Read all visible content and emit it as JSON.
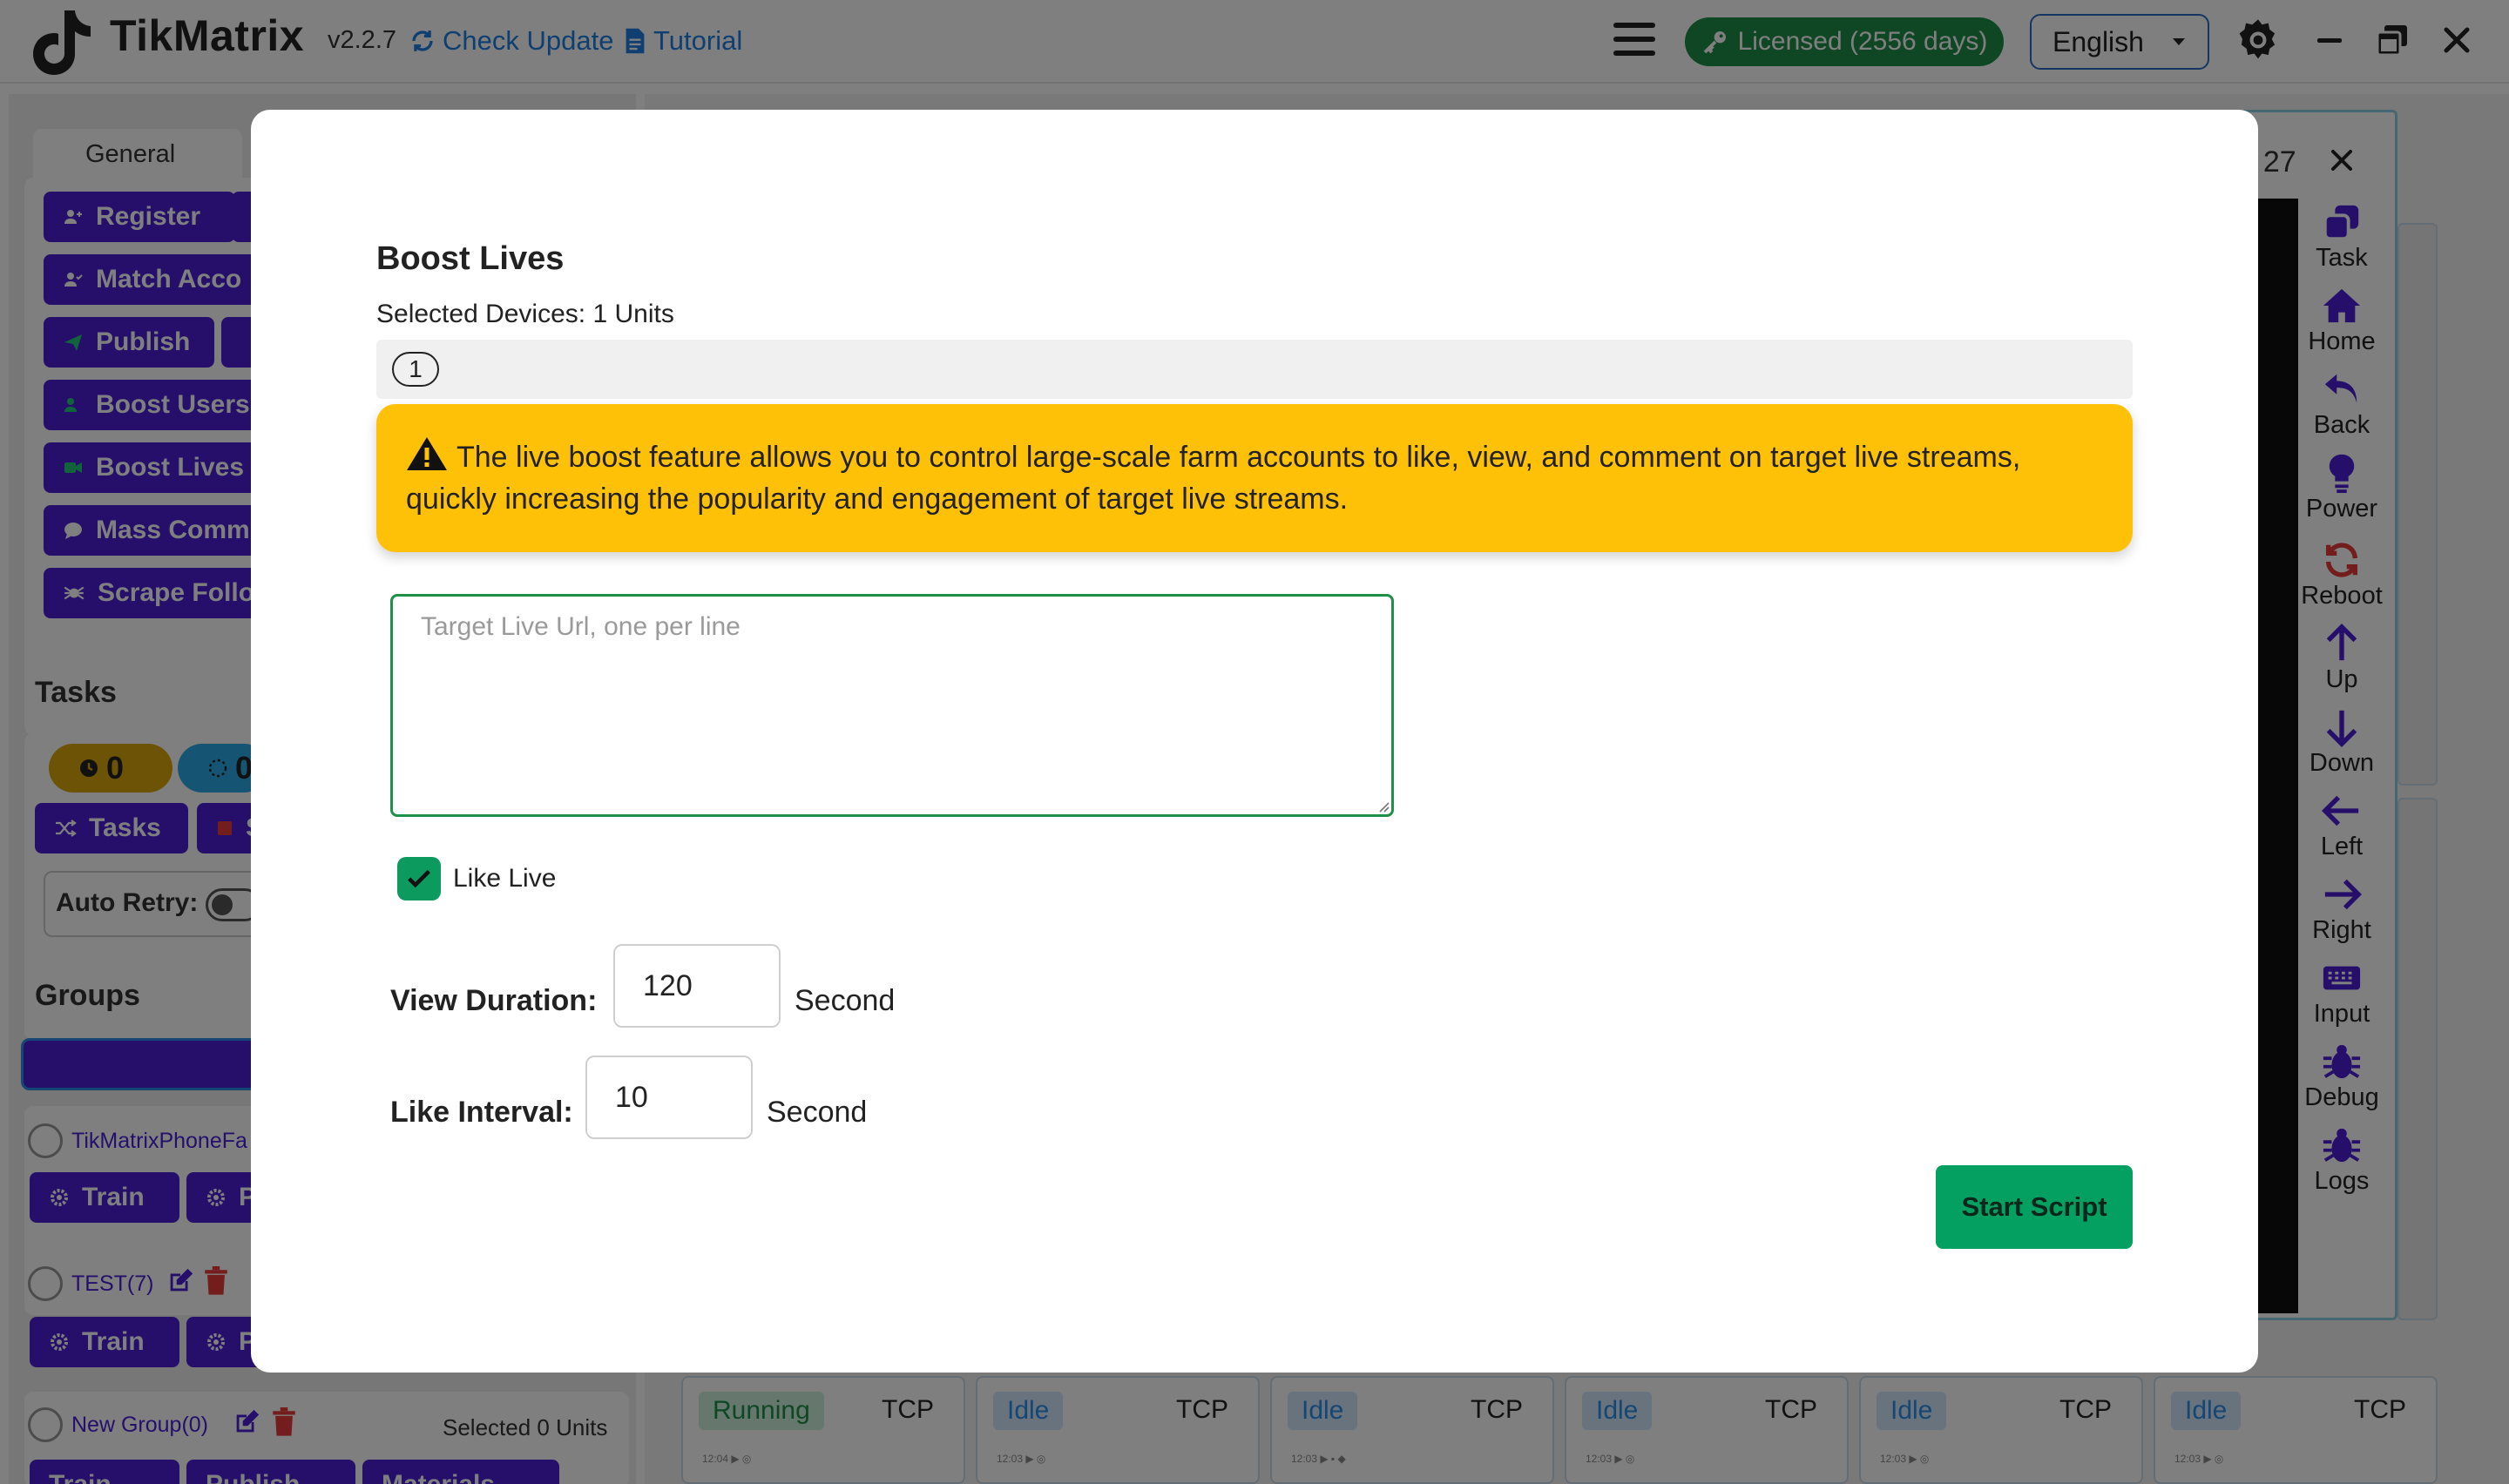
{
  "app": {
    "name": "TikMatrix",
    "version": "v2.2.7",
    "check_update": "Check Update",
    "tutorial": "Tutorial",
    "licensed": "Licensed (2556 days)",
    "language": "English"
  },
  "sidebar": {
    "general_tab": "General",
    "general_buttons": [
      "Register",
      "Match Acco",
      "Publish",
      "Boost Users",
      "Boost Lives",
      "Mass Comm",
      "Scrape Follo"
    ],
    "tasks": {
      "title": "Tasks",
      "count_a": "0",
      "count_b": "0",
      "tasks_button": "Tasks",
      "stop_button": "S",
      "auto_retry": "Auto Retry:"
    },
    "groups": {
      "title": "Groups",
      "list": [
        {
          "name": "TikMatrixPhoneFa",
          "train": "Train",
          "second": "P"
        },
        {
          "name": "TEST(7)",
          "train": "Train",
          "second": "P"
        },
        {
          "name": "New Group(0)",
          "selected": "Selected 0 Units",
          "train": "Train",
          "publish": "Publish",
          "materials": "Materials"
        }
      ]
    }
  },
  "device_panel": {
    "count_fragment": ": 27",
    "controls": [
      "Task",
      "Home",
      "Back",
      "Power",
      "Reboot",
      "Up",
      "Down",
      "Left",
      "Right",
      "Input",
      "Debug",
      "Logs"
    ]
  },
  "device_cards": [
    {
      "status": "Running",
      "conn": "TCP",
      "mini": "12:04 ▶ ◎"
    },
    {
      "status": "Idle",
      "conn": "TCP",
      "mini": "12:03 ▶ ◎"
    },
    {
      "status": "Idle",
      "conn": "TCP",
      "mini": "12:03 ▶ ▪ ◆"
    },
    {
      "status": "Idle",
      "conn": "TCP",
      "mini": "12:03 ▶ ◎"
    },
    {
      "status": "Idle",
      "conn": "TCP",
      "mini": "12:03 ▶ ◎"
    },
    {
      "status": "Idle",
      "conn": "TCP",
      "mini": "12:03 ▶ ◎"
    }
  ],
  "modal": {
    "title": "Boost Lives",
    "selected_devices": "Selected Devices: 1 Units",
    "device_chip": "1",
    "warning": "The live boost feature allows you to control large-scale farm accounts to like, view, and comment on target live streams, quickly increasing the popularity and engagement of target live streams.",
    "url_placeholder": "Target Live Url, one per line",
    "like_live_label": "Like Live",
    "like_live_checked": true,
    "view_duration_label": "View Duration:",
    "view_duration_value": "120",
    "view_duration_unit": "Second",
    "like_interval_label": "Like Interval:",
    "like_interval_value": "10",
    "like_interval_unit": "Second",
    "start_button": "Start Script"
  },
  "colors": {
    "primary_purple": "#4a1fd6",
    "licensed_green": "#1f8f4a",
    "warning_yellow": "#ffc107",
    "start_green": "#03a061",
    "link_blue": "#1f7fe0"
  },
  "icons": [
    "tiktok-logo-icon",
    "refresh-icon",
    "file-icon",
    "hamburger-icon",
    "key-icon",
    "gear-icon",
    "minimize-icon",
    "restore-icon",
    "close-icon",
    "warning-icon",
    "check-icon"
  ]
}
